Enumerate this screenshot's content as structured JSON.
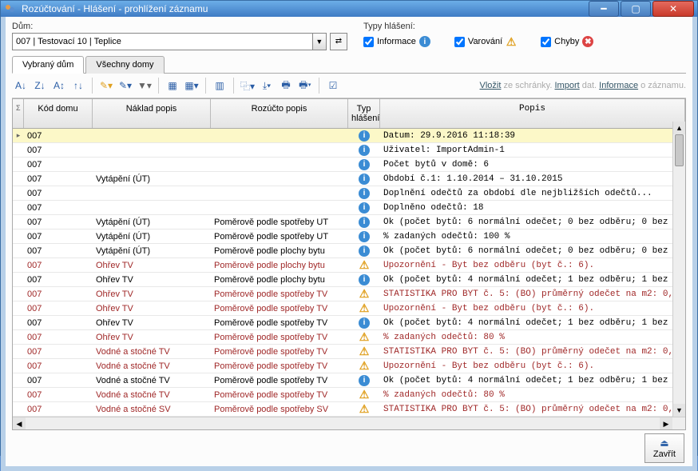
{
  "window": {
    "title": "Rozúčtování - Hlášení - prohlížení záznamu"
  },
  "filters": {
    "dum_label": "Dům:",
    "dum_value": "007 | Testovací 10 | Teplice",
    "typy_label": "Typy hlášení:",
    "info": "Informace",
    "warn": "Varování",
    "err": "Chyby"
  },
  "tabs": {
    "t0": "Vybraný dům",
    "t1": "Všechny domy"
  },
  "toolbar_links": {
    "vlozit": "Vložit",
    "vlozit2": " ze schránky.",
    "import": "Import",
    "import2": " dat.",
    "info": "Informace",
    "info2": " o záznamu."
  },
  "columns": {
    "c0": "Σ",
    "c1": "Kód domu",
    "c2": "Náklad popis",
    "c3": "Rozúčto popis",
    "c4": "Typ hlášení",
    "c5": "Popis"
  },
  "rows": [
    {
      "sel": true,
      "ind": "▸",
      "kod": "007",
      "nak": "",
      "roz": "",
      "typ": "i",
      "popis": "Datum: 29.9.2016 11:18:39",
      "red": false
    },
    {
      "kod": "007",
      "nak": "",
      "roz": "",
      "typ": "i",
      "popis": "Uživatel: ImportAdmin-1",
      "red": false
    },
    {
      "kod": "007",
      "nak": "",
      "roz": "",
      "typ": "i",
      "popis": "Počet bytů v domě: 6",
      "red": false
    },
    {
      "kod": "007",
      "nak": "Vytápění (ÚT)",
      "roz": "",
      "typ": "i",
      "popis": "Období č.1: 1.10.2014 – 31.10.2015",
      "red": false
    },
    {
      "kod": "007",
      "nak": "",
      "roz": "",
      "typ": "i",
      "popis": "Doplnění odečtů za období dle nejbližších odečtů...",
      "red": false
    },
    {
      "kod": "007",
      "nak": "",
      "roz": "",
      "typ": "i",
      "popis": "Doplněno odečtů: 18",
      "red": false
    },
    {
      "kod": "007",
      "nak": "Vytápění (ÚT)",
      "roz": "Poměrově podle spotřeby UT",
      "typ": "i",
      "popis": "Ok (počet bytů: 6 normální odečet; 0 bez odběru; 0 bez",
      "red": false
    },
    {
      "kod": "007",
      "nak": "Vytápění (ÚT)",
      "roz": "Poměrově podle spotřeby UT",
      "typ": "i",
      "popis": "% zadaných odečtů: 100 %",
      "red": false
    },
    {
      "kod": "007",
      "nak": "Vytápění (ÚT)",
      "roz": "Poměrově podle plochy bytu",
      "typ": "i",
      "popis": "Ok (počet bytů: 6 normální odečet; 0 bez odběru; 0 bez",
      "red": false
    },
    {
      "kod": "007",
      "nak": "Ohřev TV",
      "roz": "Poměrově podle plochy bytu",
      "typ": "w",
      "popis": "Upozornění - Byt bez odběru (byt č.: 6).",
      "red": true
    },
    {
      "kod": "007",
      "nak": "Ohřev TV",
      "roz": "Poměrově podle plochy bytu",
      "typ": "i",
      "popis": "Ok (počet bytů: 4 normální odečet; 1 bez odběru; 1 bez",
      "red": false
    },
    {
      "kod": "007",
      "nak": "Ohřev TV",
      "roz": "Poměrově podle spotřeby TV",
      "typ": "w",
      "popis": "STATISTIKA PRO BYT č. 5: (BO) průměrný odečet na m2: 0,",
      "red": true
    },
    {
      "kod": "007",
      "nak": "Ohřev TV",
      "roz": "Poměrově podle spotřeby TV",
      "typ": "w",
      "popis": "Upozornění - Byt bez odběru (byt č.: 6).",
      "red": true
    },
    {
      "kod": "007",
      "nak": "Ohřev TV",
      "roz": "Poměrově podle spotřeby TV",
      "typ": "i",
      "popis": "Ok (počet bytů: 4 normální odečet; 1 bez odběru; 1 bez",
      "red": false
    },
    {
      "kod": "007",
      "nak": "Ohřev TV",
      "roz": "Poměrově podle spotřeby TV",
      "typ": "w",
      "popis": "% zadaných odečtů: 80 %",
      "red": true
    },
    {
      "kod": "007",
      "nak": "Vodné a stočné TV",
      "roz": "Poměrově podle spotřeby TV",
      "typ": "w",
      "popis": "STATISTIKA PRO BYT č. 5: (BO) průměrný odečet na m2: 0,",
      "red": true
    },
    {
      "kod": "007",
      "nak": "Vodné a stočné TV",
      "roz": "Poměrově podle spotřeby TV",
      "typ": "w",
      "popis": "Upozornění - Byt bez odběru (byt č.: 6).",
      "red": true
    },
    {
      "kod": "007",
      "nak": "Vodné a stočné TV",
      "roz": "Poměrově podle spotřeby TV",
      "typ": "i",
      "popis": "Ok (počet bytů: 4 normální odečet; 1 bez odběru; 1 bez",
      "red": false
    },
    {
      "kod": "007",
      "nak": "Vodné a stočné TV",
      "roz": "Poměrově podle spotřeby TV",
      "typ": "w",
      "popis": "% zadaných odečtů: 80 %",
      "red": true
    },
    {
      "kod": "007",
      "nak": "Vodné a stočné SV",
      "roz": "Poměrově podle spotřeby SV",
      "typ": "w",
      "popis": "STATISTIKA PRO BYT č. 5: (BO) průměrný odečet na m2: 0,",
      "red": true
    }
  ],
  "footer": {
    "close": "Zavřít"
  }
}
